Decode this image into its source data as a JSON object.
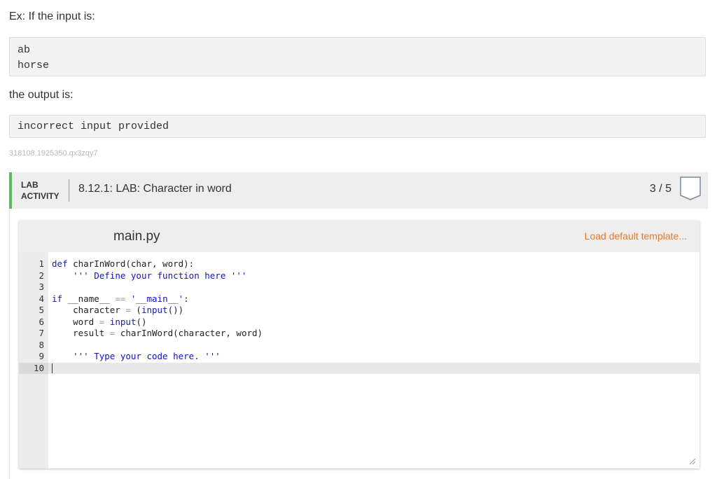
{
  "prose": {
    "example_intro": "Ex: If the input is:",
    "output_intro": "the output is:"
  },
  "input_example": [
    "ab",
    "horse"
  ],
  "output_example": "incorrect input provided",
  "caption_id": "318108.1925350.qx3zqy7",
  "lab": {
    "tag_line1": "LAB",
    "tag_line2": "ACTIVITY",
    "title": "8.12.1: LAB: Character in word",
    "score": "3 / 5",
    "accent_color": "#5cb85c"
  },
  "editor": {
    "filename": "main.py",
    "load_template": "Load default template...",
    "load_template_color": "#e87722",
    "line_numbers": [
      "1",
      "2",
      "3",
      "4",
      "5",
      "6",
      "7",
      "8",
      "9",
      "10"
    ],
    "lines": [
      [
        {
          "t": "kw",
          "v": "def"
        },
        {
          "t": "plain",
          "v": " charInWord(char, word):"
        }
      ],
      [
        {
          "t": "plain",
          "v": "    "
        },
        {
          "t": "str",
          "v": "''' Define your function here '''"
        }
      ],
      [],
      [
        {
          "t": "kw",
          "v": "if"
        },
        {
          "t": "plain",
          "v": " __name__ "
        },
        {
          "t": "op",
          "v": "=="
        },
        {
          "t": "plain",
          "v": " "
        },
        {
          "t": "str",
          "v": "'__main__'"
        },
        {
          "t": "plain",
          "v": ":"
        }
      ],
      [
        {
          "t": "plain",
          "v": "    character "
        },
        {
          "t": "op",
          "v": "="
        },
        {
          "t": "plain",
          "v": " ("
        },
        {
          "t": "kw",
          "v": "input"
        },
        {
          "t": "plain",
          "v": "())"
        }
      ],
      [
        {
          "t": "plain",
          "v": "    word "
        },
        {
          "t": "op",
          "v": "="
        },
        {
          "t": "plain",
          "v": " "
        },
        {
          "t": "kw",
          "v": "input"
        },
        {
          "t": "plain",
          "v": "()"
        }
      ],
      [
        {
          "t": "plain",
          "v": "    result "
        },
        {
          "t": "op",
          "v": "="
        },
        {
          "t": "plain",
          "v": " charInWord(character, word)"
        }
      ],
      [],
      [
        {
          "t": "plain",
          "v": "    "
        },
        {
          "t": "str",
          "v": "''' Type your code here. '''"
        }
      ],
      []
    ],
    "active_line": 10
  }
}
